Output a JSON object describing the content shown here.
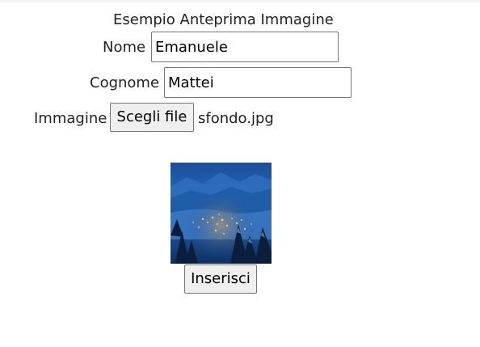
{
  "form": {
    "title": "Esempio Anteprima Immagine",
    "nome_label": "Nome",
    "nome_value": "Emanuele",
    "cognome_label": "Cognome",
    "cognome_value": "Mattei",
    "immagine_label": "Immagine",
    "choose_file_label": "Scegli file",
    "file_name": "sfondo.jpg",
    "submit_label": "Inserisci"
  },
  "preview": {
    "description_icon": "winter-night-village-photo"
  }
}
